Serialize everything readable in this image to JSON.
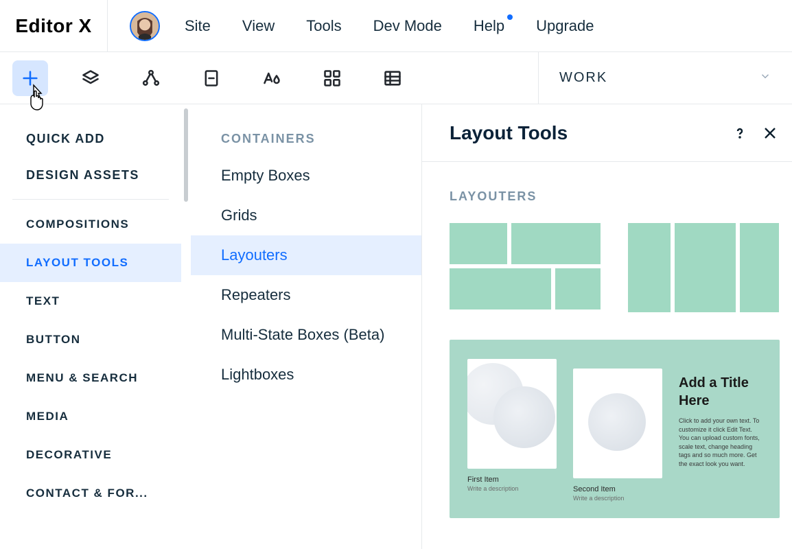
{
  "brand": "Editor X",
  "topMenu": {
    "site": "Site",
    "view": "View",
    "tools": "Tools",
    "devMode": "Dev Mode",
    "help": "Help",
    "upgrade": "Upgrade"
  },
  "pageDropdown": {
    "label": "WORK"
  },
  "leftPanel": {
    "quickAdd": "QUICK ADD",
    "designAssets": "DESIGN ASSETS",
    "categories": {
      "compositions": "COMPOSITIONS",
      "layoutTools": "LAYOUT TOOLS",
      "text": "TEXT",
      "button": "BUTTON",
      "menuSearch": "MENU & SEARCH",
      "media": "MEDIA",
      "decorative": "DECORATIVE",
      "contactForm": "CONTACT & FOR..."
    }
  },
  "subPanel": {
    "heading": "CONTAINERS",
    "items": {
      "emptyBoxes": "Empty Boxes",
      "grids": "Grids",
      "layouters": "Layouters",
      "repeaters": "Repeaters",
      "multiState": "Multi-State Boxes (Beta)",
      "lightboxes": "Lightboxes"
    }
  },
  "detailPanel": {
    "title": "Layout Tools",
    "subheading": "LAYOUTERS",
    "showcase": {
      "firstItemTitle": "First Item",
      "firstItemDesc": "Write a description",
      "secondItemTitle": "Second Item",
      "secondItemDesc": "Write a description",
      "textTitle": "Add a Title Here",
      "textDesc": "Click to add your own text. To customize it click Edit Text. You can upload custom fonts, scale text, change heading tags and so much more. Get the exact look you want."
    }
  }
}
